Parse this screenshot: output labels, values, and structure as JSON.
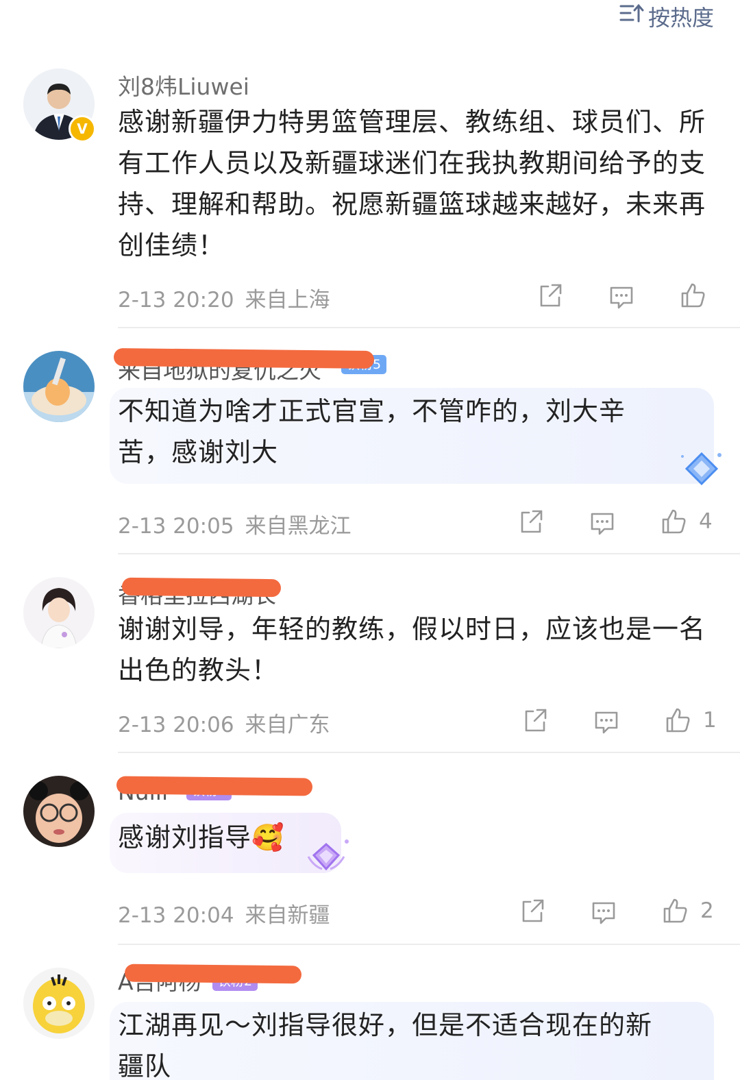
{
  "sort": {
    "label": "按热度"
  },
  "comments": [
    {
      "username": "刘8炜Liuwei",
      "verified": true,
      "text": "感谢新疆伊力特男篮管理层、教练组、球员们、所有工作人员以及新疆球迷们在我执教期间给予的支持、理解和帮助。祝愿新疆篮球越来越好，未来再创佳绩！",
      "time": "2-13 20:20",
      "location": "来自上海",
      "likes": ""
    },
    {
      "username": "来自地狱的复仇之火",
      "badge": "铁粉5",
      "text": "不知道为啥才正式官宣，不管咋的，刘大辛苦，感谢刘大",
      "time": "2-13 20:05",
      "location": "来自黑龙江",
      "likes": "4"
    },
    {
      "username": "香格里拉西湖长",
      "text": "谢谢刘导，年轻的教练，假以时日，应该也是一名出色的教头！",
      "time": "2-13 20:06",
      "location": "来自广东",
      "likes": "1"
    },
    {
      "username": "Nulll",
      "badge": "铁粉2",
      "text": "感谢刘指导🥰",
      "time": "2-13 20:04",
      "location": "来自新疆",
      "likes": "2"
    },
    {
      "username": "A吉阿杨",
      "badge": "铁粉2",
      "text": "江湖再见～刘指导很好，但是不适合现在的新疆队"
    }
  ],
  "colors": {
    "accent": "#5b6b8c",
    "redaction": "#f36a3f",
    "badge_blue": "#6ea8f5",
    "badge_purple": "#b08cf0",
    "verified": "#f6b700"
  }
}
